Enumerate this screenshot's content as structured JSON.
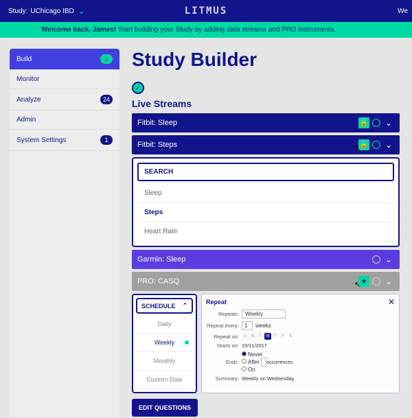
{
  "topbar": {
    "study_label": "Study:",
    "study_name": "UChicago IBD",
    "brand": "LITMUS",
    "right": "We"
  },
  "banner": {
    "bold": "Welcome back, James!",
    "rest": " Start building your Study by adding data streams and PRO instruments."
  },
  "sidebar": {
    "items": [
      {
        "label": "Build",
        "badge": "1",
        "active": true,
        "badge_style": "teal"
      },
      {
        "label": "Monitor"
      },
      {
        "label": "Analyze",
        "badge": "24",
        "badge_style": "dark"
      },
      {
        "label": "Admin"
      },
      {
        "label": "System Settings",
        "badge": "1",
        "badge_style": "dark"
      }
    ]
  },
  "page_title": "Study Builder",
  "section": "Live Streams",
  "streams": [
    {
      "title": "Fitbit: Sleep",
      "style": "navy",
      "lock": true,
      "ring": "teal"
    },
    {
      "title": "Fitbit: Steps",
      "style": "navy",
      "lock": true,
      "ring": "teal"
    },
    {
      "title": "Garmin: Sleep",
      "style": "purple",
      "lock": false,
      "ring": "gray"
    },
    {
      "title": "PRO: CASQ",
      "style": "gray",
      "lock": false,
      "ring": "gray",
      "star": true
    }
  ],
  "search": {
    "placeholder": "SEARCH",
    "options": [
      {
        "label": "Sleep"
      },
      {
        "label": "Steps",
        "selected": true
      },
      {
        "label": "Heart Rate"
      }
    ]
  },
  "schedule": {
    "header": "SCHEDULE",
    "options": [
      {
        "label": "Daily"
      },
      {
        "label": "Weekly",
        "selected": true
      },
      {
        "label": "Monthly"
      },
      {
        "label": "Custom Date"
      }
    ]
  },
  "repeat": {
    "title": "Repeat",
    "repeats_label": "Repeats:",
    "repeats_value": "Weekly",
    "every_label": "Repeat every:",
    "every_num": "1",
    "every_unit": "weeks",
    "on_label": "Repeat on:",
    "days": [
      "S",
      "M",
      "T",
      "W",
      "T",
      "F",
      "S"
    ],
    "day_selected": 3,
    "starts_label": "Starts on:",
    "starts_value": "10/11/2017",
    "ends_label": "Ends:",
    "end_options": [
      {
        "label": "Never",
        "on": true
      },
      {
        "label": "After",
        "suffix": "occurrences"
      },
      {
        "label": "On"
      }
    ],
    "summary_label": "Summary:",
    "summary_value": "Weekly on Wednesday"
  },
  "edit_btn": "EDIT QUESTIONS"
}
